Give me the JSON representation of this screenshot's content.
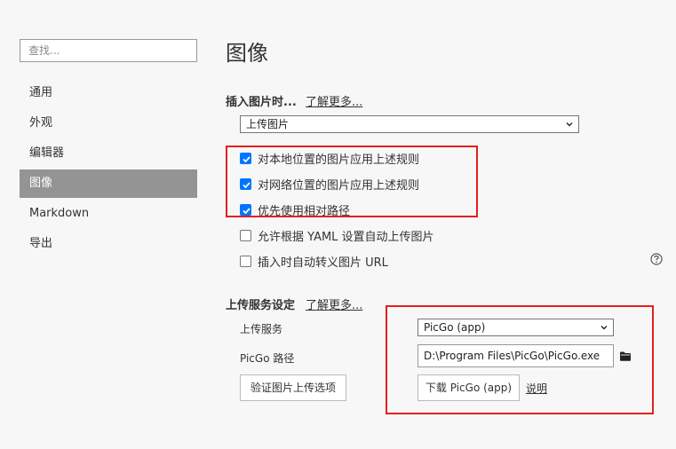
{
  "sidebar": {
    "search_placeholder": "查找...",
    "items": [
      {
        "label": "通用"
      },
      {
        "label": "外观"
      },
      {
        "label": "编辑器"
      },
      {
        "label": "图像"
      },
      {
        "label": "Markdown"
      },
      {
        "label": "导出"
      }
    ],
    "active_index": 3
  },
  "main": {
    "title": "图像",
    "insert_section": {
      "label": "插入图片时...",
      "learn_more": "了解更多...",
      "select_value": "上传图片",
      "checkboxes": [
        {
          "label": "对本地位置的图片应用上述规则",
          "checked": true
        },
        {
          "label": "对网络位置的图片应用上述规则",
          "checked": true
        },
        {
          "label": "优先使用相对路径",
          "checked": true
        },
        {
          "label": "允许根据 YAML 设置自动上传图片",
          "checked": false
        },
        {
          "label": "插入时自动转义图片 URL",
          "checked": false
        }
      ]
    },
    "upload_section": {
      "label": "上传服务设定",
      "learn_more": "了解更多...",
      "service_label": "上传服务",
      "service_value": "PicGo (app)",
      "path_label": "PicGo 路径",
      "path_value": "D:\\Program Files\\PicGo\\PicGo.exe",
      "verify_button": "验证图片上传选项",
      "download_button": "下载 PicGo (app)",
      "explain_link": "说明"
    }
  },
  "colors": {
    "accent": "#0075ff",
    "highlight_box": "#e02020",
    "active_nav": "#949494"
  }
}
